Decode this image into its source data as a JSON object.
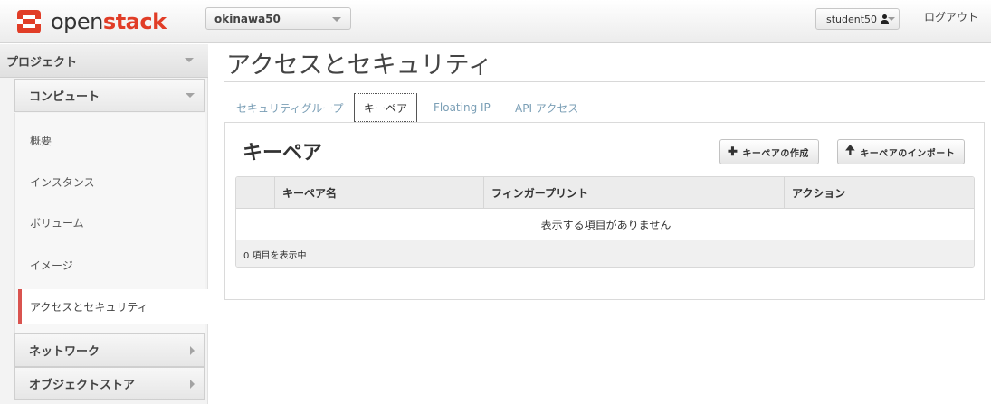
{
  "header": {
    "logo_open": "open",
    "logo_stack": "stack",
    "project": "okinawa50",
    "user": "student50",
    "logout": "ログアウト"
  },
  "sidebar": {
    "dashboard": "プロジェクト",
    "panel": "コンピュート",
    "items": [
      "概要",
      "インスタンス",
      "ボリューム",
      "イメージ"
    ],
    "active_item": "アクセスとセキュリティ",
    "groups": [
      "ネットワーク",
      "オブジェクトストア"
    ]
  },
  "main": {
    "title": "アクセスとセキュリティ",
    "tabs": [
      {
        "label": "セキュリティグループ",
        "active": false
      },
      {
        "label": "キーペア",
        "active": true
      },
      {
        "label": "Floating IP",
        "active": false
      },
      {
        "label": "API アクセス",
        "active": false
      }
    ],
    "panel_title": "キーペア",
    "create_button": "キーペアの作成",
    "import_button": "キーペアのインポート",
    "table": {
      "columns": [
        "",
        "キーペア名",
        "フィンガープリント",
        "アクション"
      ],
      "empty_message": "表示する項目がありません",
      "footer": "0 項目を表示中"
    }
  },
  "colors": {
    "accent": "#e13d27",
    "active_marker": "#d9534f",
    "tab_link": "#7b9fb6"
  }
}
